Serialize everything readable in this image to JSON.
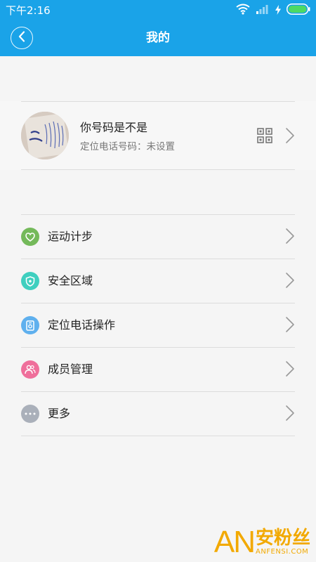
{
  "status_bar": {
    "time": "下午2:16"
  },
  "nav": {
    "title": "我的"
  },
  "profile": {
    "name": "你号码是不是",
    "subtitle": "定位电话号码：未设置"
  },
  "menu": [
    {
      "label": "运动计步",
      "icon": "heart-icon",
      "color": "#74b95a"
    },
    {
      "label": "安全区域",
      "icon": "shield-icon",
      "color": "#3fcfbf"
    },
    {
      "label": "定位电话操作",
      "icon": "phone-device-icon",
      "color": "#5fb0ee"
    },
    {
      "label": "成员管理",
      "icon": "members-icon",
      "color": "#ef6f9b"
    },
    {
      "label": "更多",
      "icon": "more-icon",
      "color": "#aab0ba"
    }
  ],
  "watermark": {
    "logo": "AN",
    "name": "安粉丝",
    "domain": "ANFENSI.COM"
  },
  "colors": {
    "header": "#1aa3e8",
    "background": "#f5f5f5",
    "divider": "#dcdcdc"
  }
}
